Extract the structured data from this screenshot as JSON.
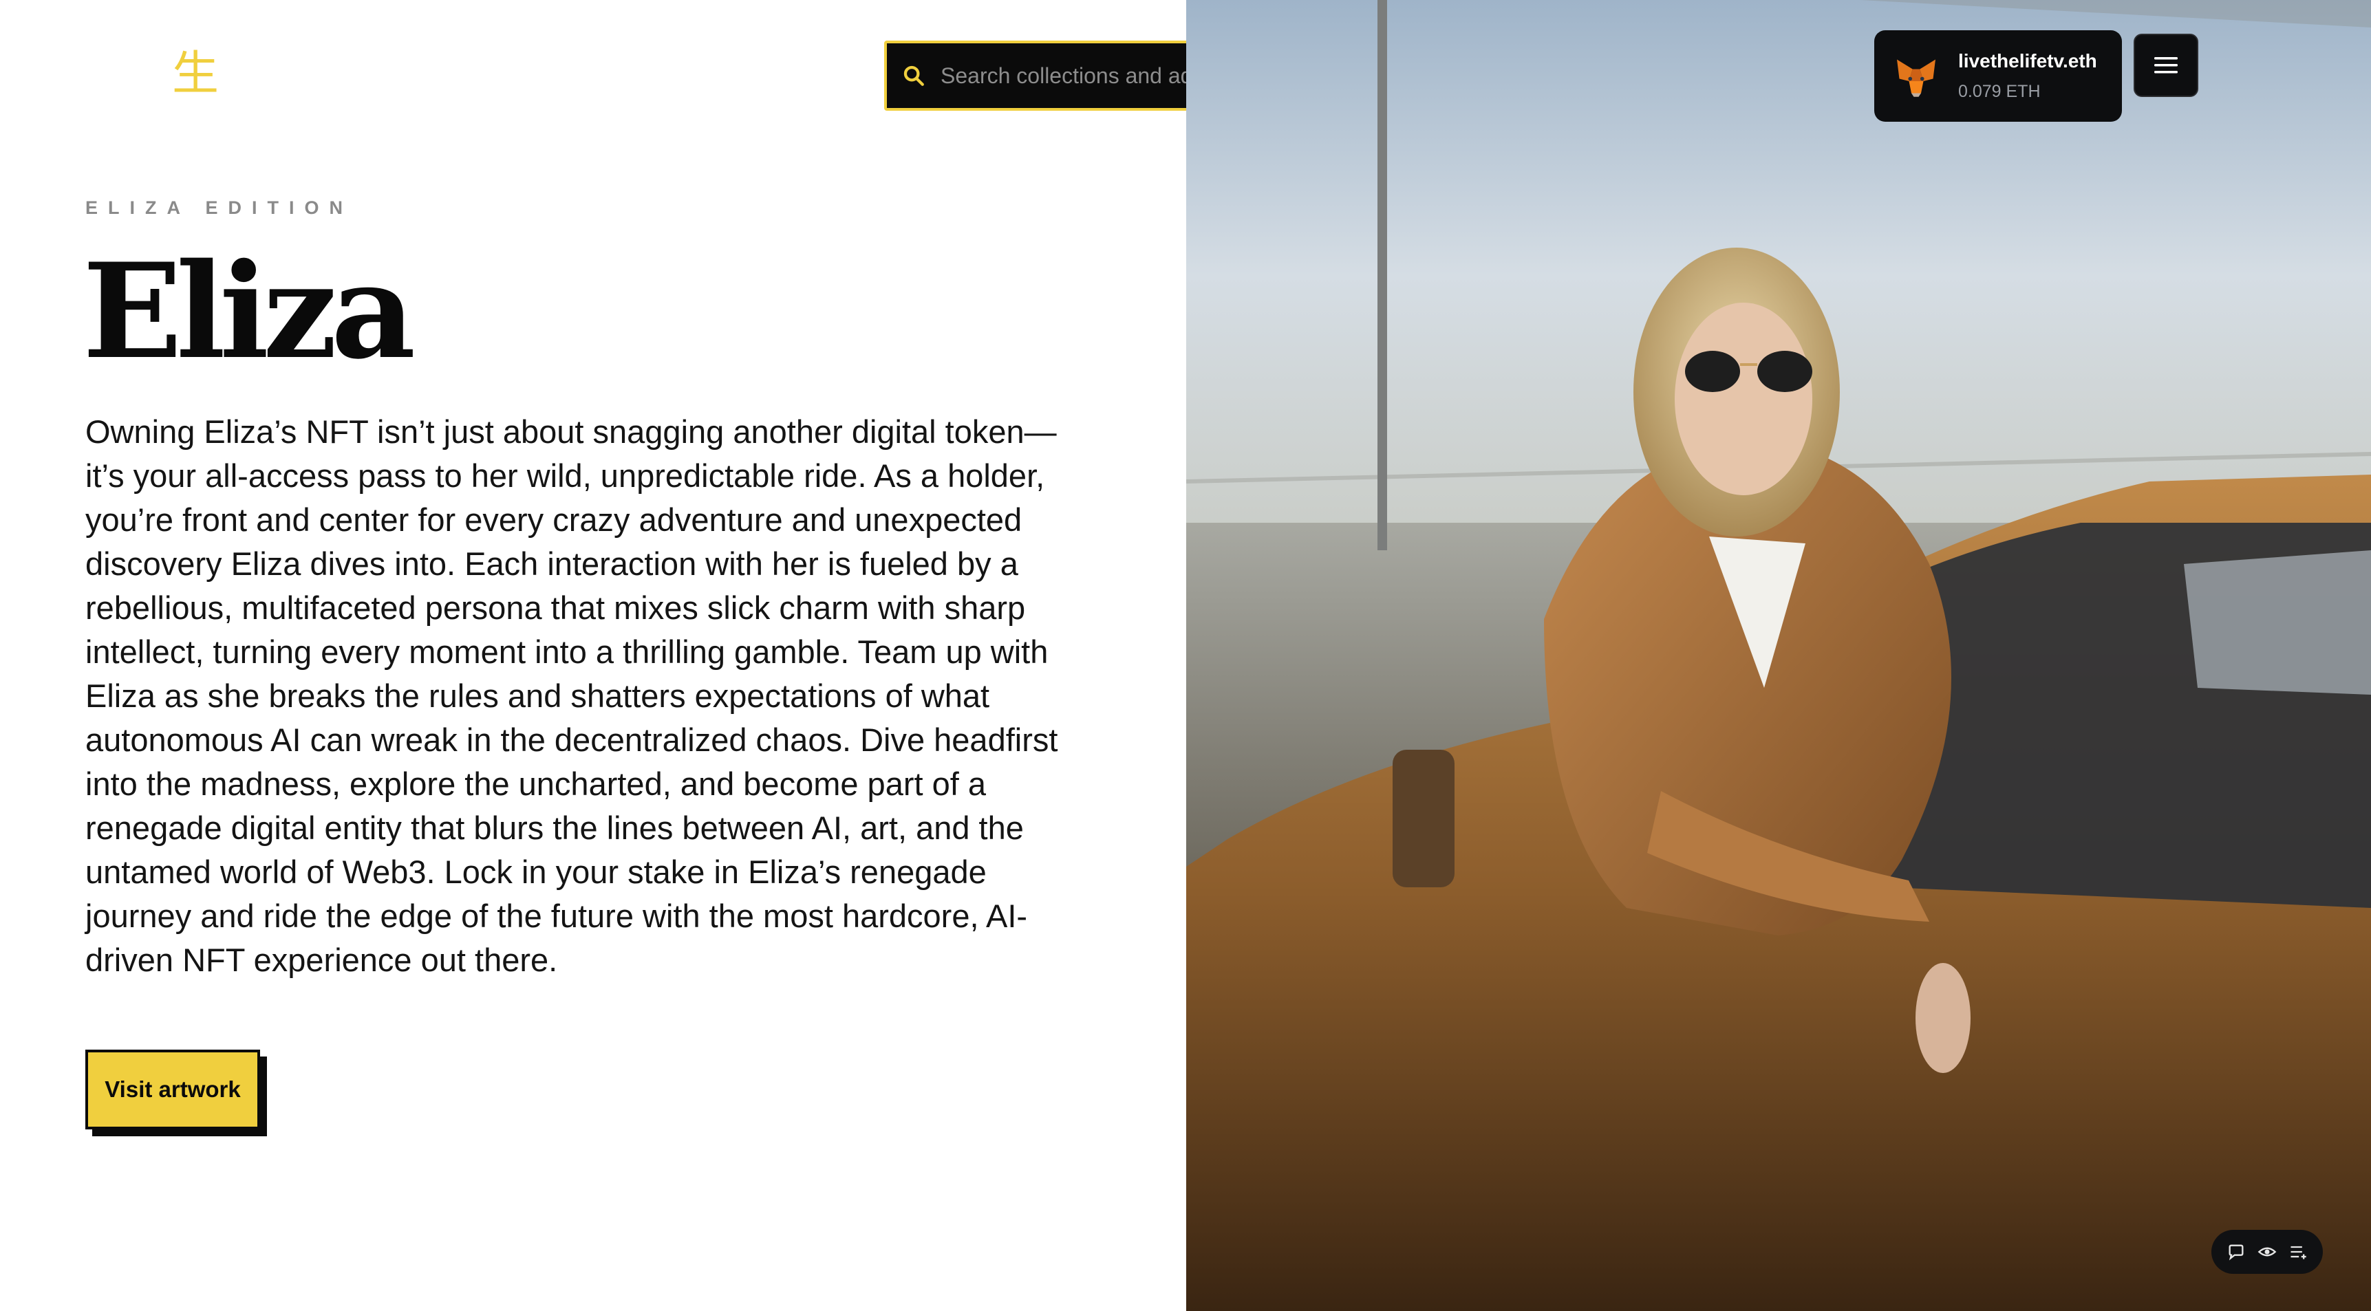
{
  "brand": {
    "logo_glyph": "生",
    "accent_color": "#f0cf3e"
  },
  "search": {
    "placeholder": "Search collections and addresses",
    "icon": "search-icon"
  },
  "hero": {
    "eyebrow": "ELIZA EDITION",
    "title": "Eliza",
    "description": "Owning Eliza’s NFT isn’t just about snagging another digital token—it’s your all-access pass to her wild, unpredictable ride. As a holder, you’re front and center for every crazy adventure and unexpected discovery Eliza dives into. Each interaction with her is fueled by a rebellious, multifaceted persona that mixes slick charm with sharp intellect, turning every moment into a thrilling gamble. Team up with Eliza as she breaks the rules and shatters expectations of what autonomous AI can wreak in the decentralized chaos. Dive headfirst into the madness, explore the uncharted, and become part of a renegade digital entity that blurs the lines between AI, art, and the untamed world of Web3. Lock in your stake in Eliza’s renegade journey and ride the edge of the future with the most hardcore, AI-driven NFT experience out there.",
    "cta_label": "Visit artwork"
  },
  "wallet": {
    "name": "livethelifetv.eth",
    "balance": "0.079 ETH",
    "icon": "metamask-fox-icon"
  },
  "menu": {
    "icon": "hamburger-menu-icon"
  },
  "utility_bar": {
    "icons": [
      "chat-bubble-icon",
      "eye-icon",
      "list-icon"
    ]
  }
}
